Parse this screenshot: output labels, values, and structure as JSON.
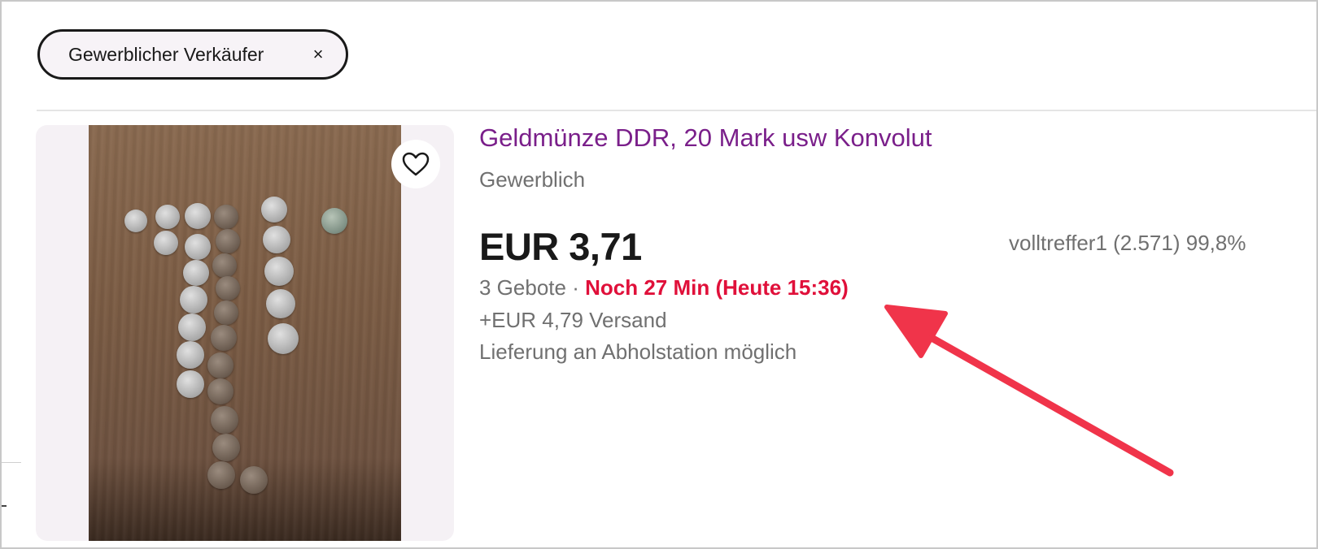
{
  "filter_chip": {
    "label": "Gewerblicher Verkäufer",
    "close_glyph": "×"
  },
  "listing": {
    "title": "Geldmünze DDR, 20 Mark usw Konvolut",
    "seller_type": "Gewerblich",
    "price": "EUR 3,71",
    "bids": "3 Gebote",
    "separator": " · ",
    "time_left": "Noch 27 Min (Heute 15:36)",
    "shipping": "+EUR 4,79 Versand",
    "delivery_note": "Lieferung an Abholstation möglich",
    "seller_info": "volltreffer1 (2.571) 99,8%",
    "watch_icon": "heart-icon",
    "image_subject": "coins-on-wooden-table"
  },
  "annotation": {
    "arrow_color": "#f0344a"
  },
  "colors": {
    "title": "#7a1f8a",
    "time_left": "#e0103a",
    "secondary_text": "#707070",
    "price": "#191919"
  }
}
